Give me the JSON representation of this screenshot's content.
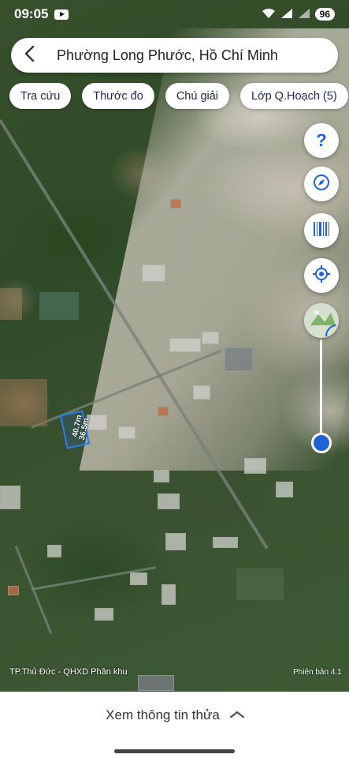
{
  "status_bar": {
    "time": "09:05",
    "battery": "96"
  },
  "search": {
    "back_icon": "arrow-back-icon",
    "title": "Phường Long Phước, Hồ Chí Minh"
  },
  "chips": [
    {
      "label": "Tra cứu"
    },
    {
      "label": "Thước đo"
    },
    {
      "label": "Chú giải"
    },
    {
      "label": "Lớp Q.Hoạch (5)"
    }
  ],
  "fabs": {
    "help_icon": "help-icon",
    "compass_icon": "compass-icon",
    "barcode_icon": "barcode-icon",
    "locate_icon": "my-location-icon",
    "layer_icon": "map-layer-icon"
  },
  "parcel": {
    "dim_a": "40.7m",
    "dim_b": "36.5m"
  },
  "map": {
    "layer_label": "TP.Thủ Đức - QHXD Phân khu",
    "version_label": "Phiên bản 4.1"
  },
  "bottom_sheet": {
    "label": "Xem thông tin thửa"
  },
  "colors": {
    "accent": "#1e63d6",
    "chip_text": "#1b2a4a"
  }
}
